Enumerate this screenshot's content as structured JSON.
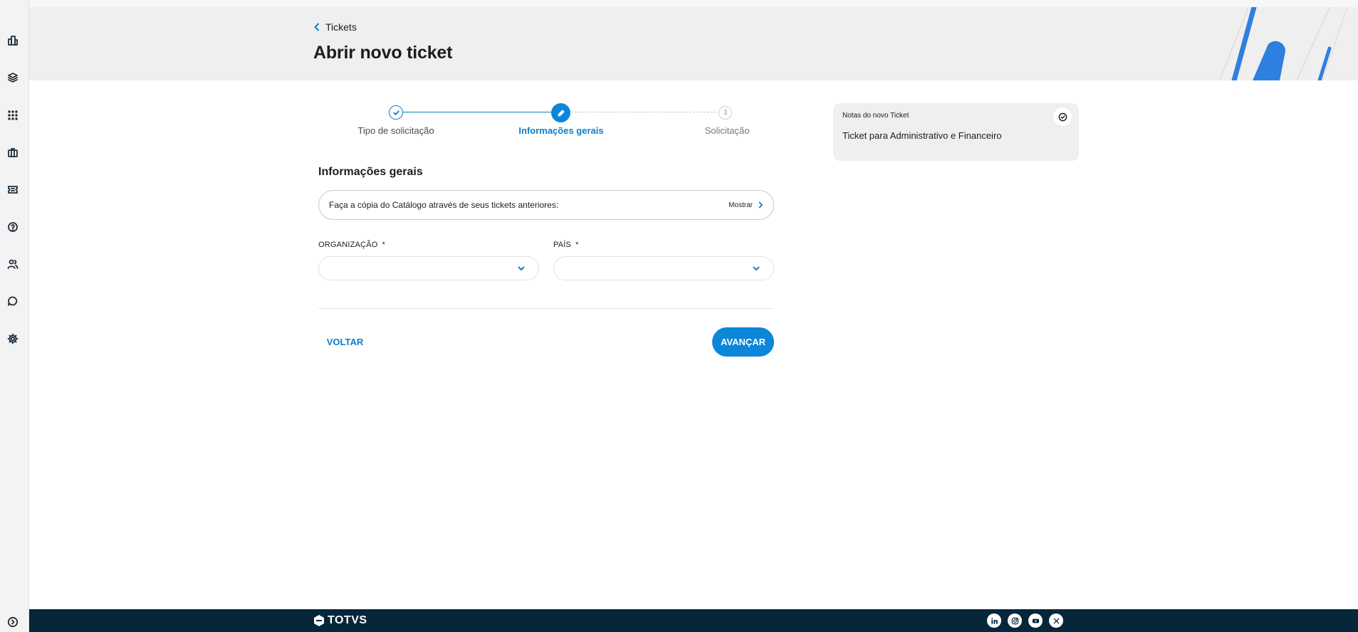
{
  "breadcrumb": {
    "back_label": "Tickets"
  },
  "header": {
    "title": "Abrir novo ticket"
  },
  "stepper": {
    "steps": [
      {
        "label": "Tipo de solicitação",
        "state": "done"
      },
      {
        "label": "Informações gerais",
        "state": "active"
      },
      {
        "label": "Solicitação",
        "state": "pending",
        "number": "3"
      }
    ]
  },
  "form": {
    "section_title": "Informações gerais",
    "copy_prompt": "Faça a cópia do Catálogo através de seus tickets anteriores:",
    "copy_action": "Mostrar",
    "fields": [
      {
        "label": "ORGANIZAÇÃO",
        "required_mark": "*",
        "value": ""
      },
      {
        "label": "PAÍS",
        "required_mark": "*",
        "value": ""
      }
    ],
    "back_button": "VOLTAR",
    "next_button": "AVANÇAR"
  },
  "notes": {
    "title": "Notas do novo Ticket",
    "body": "Ticket para Administrativo e Financeiro"
  },
  "footer": {
    "logo_text": "TOTVS",
    "socials": [
      "linkedin-icon",
      "instagram-icon",
      "youtube-icon",
      "x-icon"
    ]
  },
  "colors": {
    "accent": "#0c86d8",
    "footer_bg": "#06263a",
    "header_bg": "#efefef"
  },
  "sidebar": {
    "icons": [
      "building-icon",
      "layers-icon",
      "apps-grid-icon",
      "briefcase-icon",
      "ticket-icon",
      "help-icon",
      "users-icon",
      "chat-icon",
      "settings-icon",
      "expand-icon"
    ]
  }
}
